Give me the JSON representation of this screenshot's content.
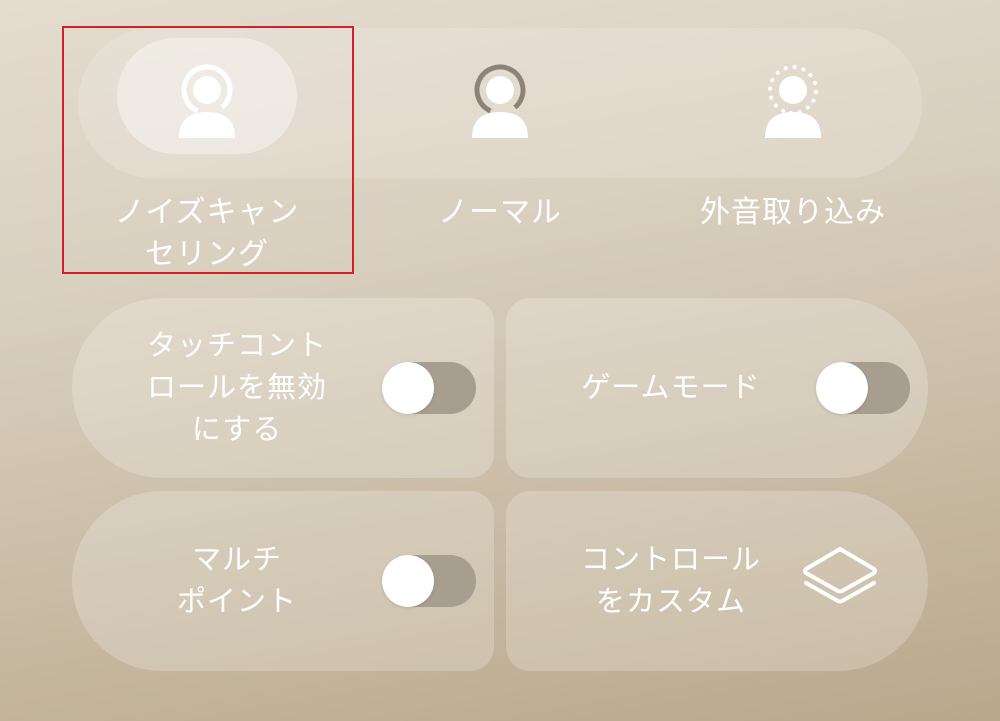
{
  "modes": [
    {
      "label": "ノイズキャン\nセリング",
      "icon": "noise-cancelling-icon",
      "selected": true
    },
    {
      "label": "ノーマル",
      "icon": "normal-mode-icon",
      "selected": false
    },
    {
      "label": "外音取り込み",
      "icon": "ambient-sound-icon",
      "selected": false
    }
  ],
  "cards": {
    "touch_control": {
      "label": "タッチコント\nロールを無効\nにする",
      "on": false
    },
    "game_mode": {
      "label": "ゲームモード",
      "on": false
    },
    "multipoint": {
      "label": "マルチ\nポイント",
      "on": false
    },
    "customize": {
      "label": "コントロール\nをカスタム",
      "icon": "layers-icon"
    }
  },
  "colors": {
    "highlight_border": "#d0202a",
    "toggle_off_track": "#a79e90",
    "text": "#ffffff"
  }
}
